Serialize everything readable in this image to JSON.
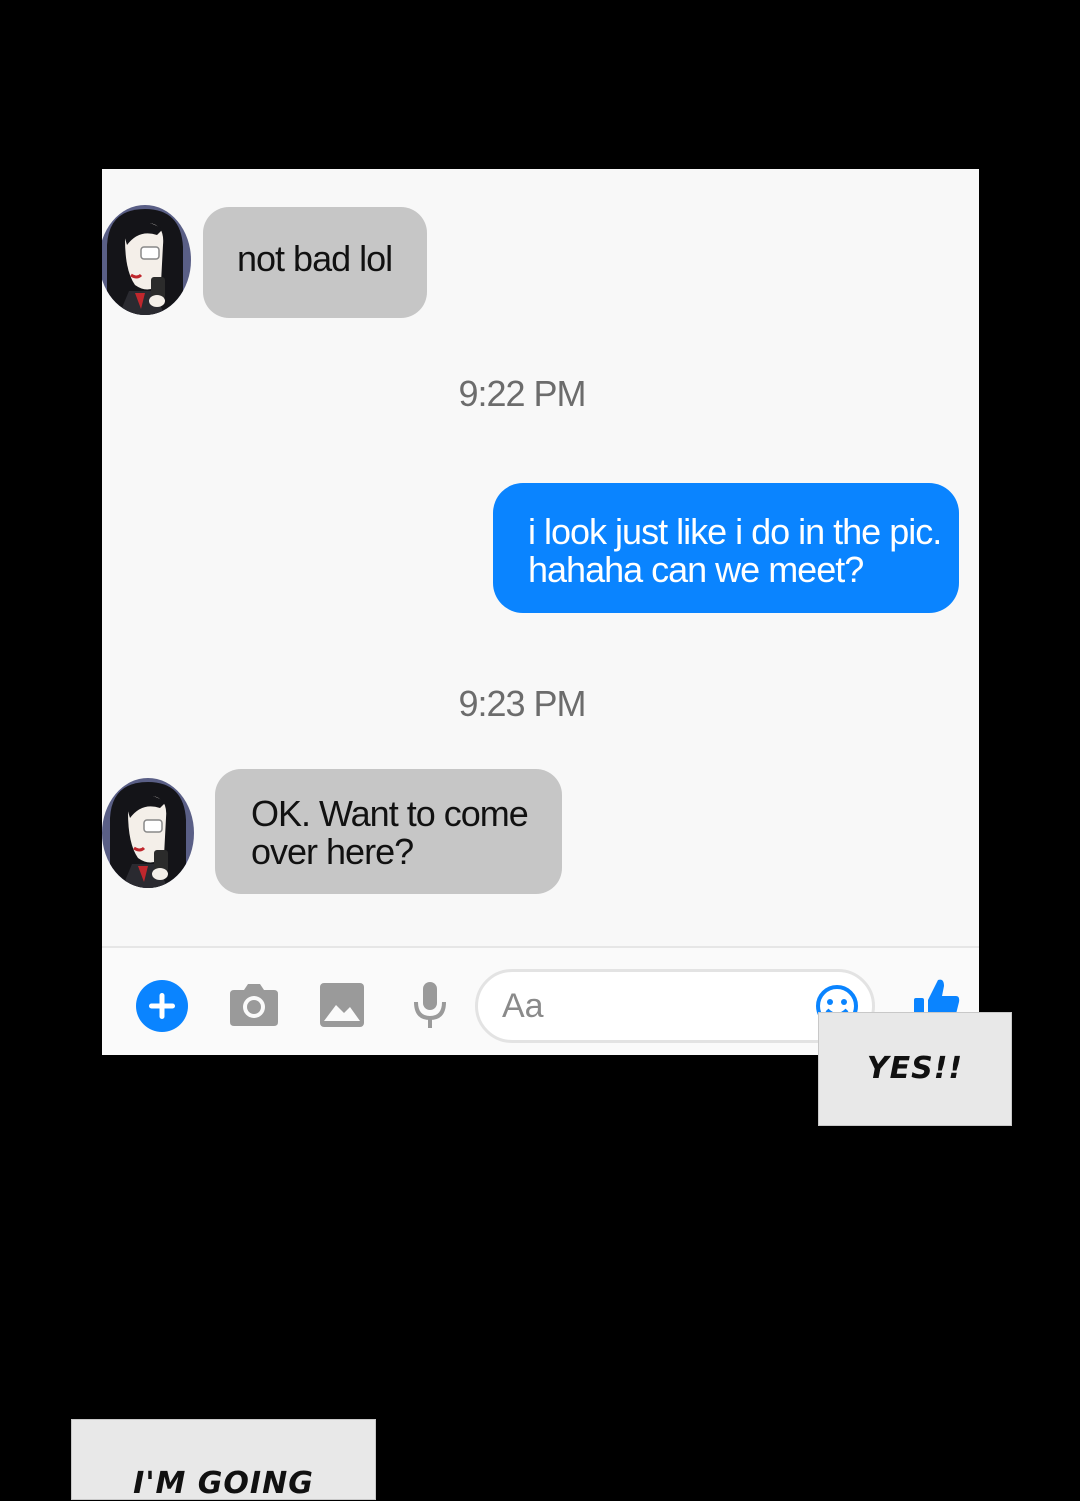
{
  "chat": {
    "messages": [
      {
        "sender": "contact",
        "text": "not bad lol"
      },
      {
        "timestamp": "9:22 PM"
      },
      {
        "sender": "me",
        "line1": "i look just like i do in the pic.",
        "line2": "hahaha can we meet?"
      },
      {
        "timestamp": "9:23 PM"
      },
      {
        "sender": "contact",
        "line1": "OK. Want to come",
        "line2": "over here?"
      }
    ]
  },
  "composer": {
    "placeholder": "Aa",
    "icons": [
      "plus-icon",
      "camera-icon",
      "image-icon",
      "microphone-icon",
      "emoji-icon",
      "thumbs-up-icon"
    ],
    "accent_color": "#0a84ff"
  },
  "captions": {
    "reply": "YES!!",
    "narration": "I'M GOING"
  },
  "colors": {
    "background": "#000000",
    "panel": "#f8f8f8",
    "incoming_bubble": "#c6c6c6",
    "outgoing_bubble": "#0a84ff"
  }
}
